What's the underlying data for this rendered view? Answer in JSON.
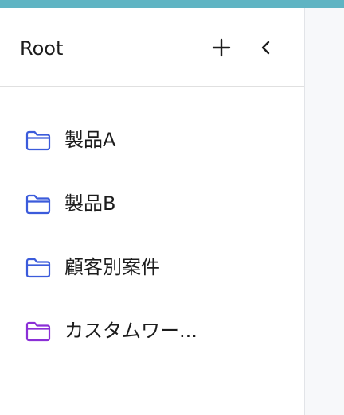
{
  "sidebar": {
    "title": "Root",
    "folders": [
      {
        "label": "製品A",
        "icon": "folder-icon",
        "color": "#3b5bdb"
      },
      {
        "label": "製品B",
        "icon": "folder-icon",
        "color": "#3b5bdb"
      },
      {
        "label": "顧客別案件",
        "icon": "folder-icon",
        "color": "#3b5bdb"
      },
      {
        "label": "カスタムワー...",
        "icon": "folder-icon",
        "color": "#8b2fd6"
      }
    ]
  },
  "colors": {
    "accent_bar": "#5fb4c3",
    "folder_blue": "#3b5bdb",
    "folder_purple": "#8b2fd6"
  }
}
